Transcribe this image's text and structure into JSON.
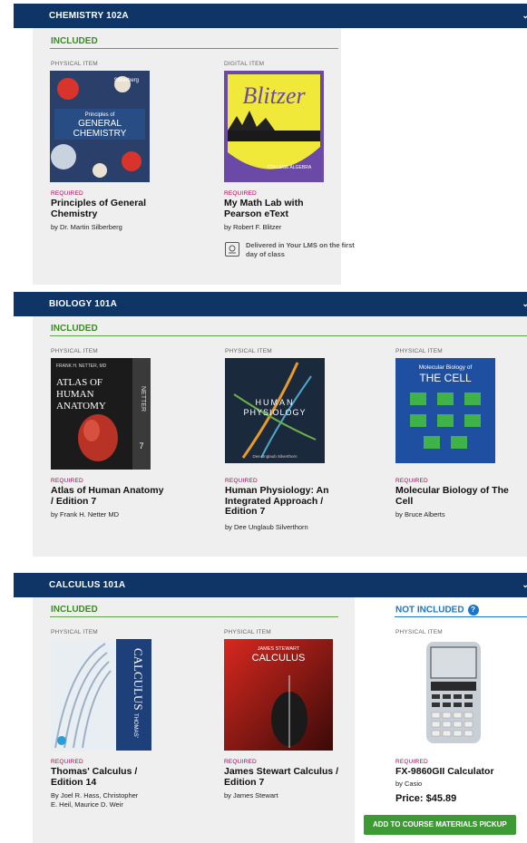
{
  "sections": [
    {
      "name": "CHEMISTRY 102A",
      "included_label": "INCLUDED",
      "items": [
        {
          "type": "PHYSICAL ITEM",
          "required": "REQUIRED",
          "title": "Principles of General Chemistry",
          "author": "by Dr. Martin Silberberg",
          "cover_lines": [
            "Silberberg",
            "Principles of",
            "GENERAL",
            "CHEMISTRY"
          ]
        },
        {
          "type": "DIGITAL ITEM",
          "required": "REQUIRED",
          "title": "My Math Lab with Pearson eText",
          "author": "by Robert F. Blitzer",
          "cover_lines": [
            "Blitzer",
            "COLLEGE ALGEBRA"
          ],
          "lms_note": "Delivered in Your LMS on the first day of class"
        }
      ]
    },
    {
      "name": "BIOLOGY 101A",
      "included_label": "INCLUDED",
      "items": [
        {
          "type": "PHYSICAL ITEM",
          "required": "REQUIRED",
          "title": "Atlas of Human Anatomy / Edition 7",
          "author": "by Frank H. Netter MD",
          "cover_lines": [
            "FRANK H. NETTER, MD",
            "ATLAS OF",
            "HUMAN",
            "ANATOMY",
            "NETTER",
            "7"
          ]
        },
        {
          "type": "PHYSICAL ITEM",
          "required": "REQUIRED",
          "title": "Human Physiology: An Integrated Approach / Edition 7",
          "author": "by Dee Unglaub Silverthorn",
          "cover_lines": [
            "HUMAN",
            "PHYSIOLOGY",
            "Dee Unglaub Silverthorn"
          ]
        },
        {
          "type": "PHYSICAL ITEM",
          "required": "REQUIRED",
          "title": "Molecular Biology of The Cell",
          "author": "by Bruce Alberts",
          "cover_lines": [
            "Molecular Biology of",
            "THE CELL"
          ]
        }
      ]
    },
    {
      "name": "CALCULUS 101A",
      "included_label": "INCLUDED",
      "not_included_label": "NOT INCLUDED",
      "items": [
        {
          "type": "PHYSICAL ITEM",
          "required": "REQUIRED",
          "title": "Thomas' Calculus / Edition 14",
          "author": "By Joel R. Hass, Christopher E. Heil, Maurice D. Weir",
          "cover_lines": [
            "CALCULUS",
            "THOMAS'"
          ]
        },
        {
          "type": "PHYSICAL ITEM",
          "required": "REQUIRED",
          "title": "James Stewart Calculus / Edition 7",
          "author": "by James Stewart",
          "cover_lines": [
            "JAMES STEWART",
            "CALCULUS"
          ]
        }
      ],
      "extra": {
        "type": "PHYSICAL ITEM",
        "required": "REQUIRED",
        "title": "FX-9860GII Calculator",
        "author": "by Casio",
        "price": "Price: $45.89",
        "button": "ADD TO COURSE MATERIALS PICKUP"
      }
    }
  ],
  "colors": {
    "header": "#0e3565",
    "included": "#3c8c26",
    "required": "#b4005a",
    "not_included": "#1976c9",
    "button": "#3e9a34"
  }
}
